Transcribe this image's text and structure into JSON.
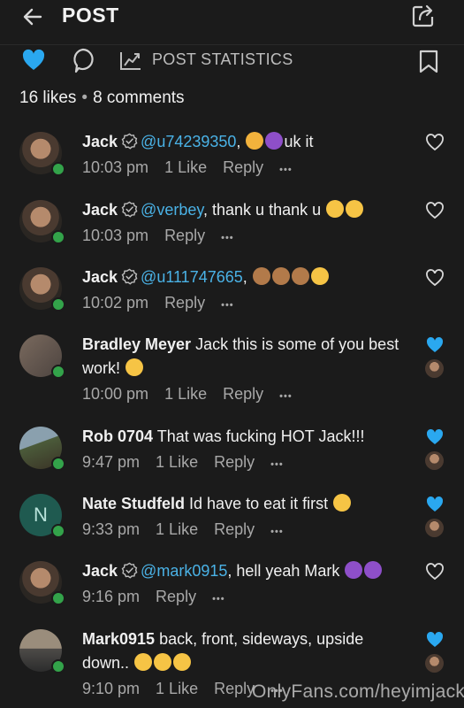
{
  "header": {
    "title": "POST"
  },
  "actions": {
    "stats_label": "POST STATISTICS",
    "accent": "#2aa8f0"
  },
  "summary": {
    "likes": "16 likes",
    "separator": "•",
    "comments": "8 comments"
  },
  "comments": [
    {
      "name": "Jack",
      "verified": true,
      "mention": "@u74239350",
      "text_before": ",",
      "emojis": [
        "flexed-biceps",
        "smiling-devil"
      ],
      "text_after": "uk it",
      "time": "10:03 pm",
      "likes": "1 Like",
      "reply": "Reply",
      "more": "•••",
      "liked": false
    },
    {
      "name": "Jack",
      "verified": true,
      "mention": "@verbey",
      "text_before": ", thank u thank u",
      "emojis": [
        "relieved-face",
        "relieved-face"
      ],
      "text_after": "",
      "time": "10:03 pm",
      "likes": "",
      "reply": "Reply",
      "more": "•••",
      "liked": false
    },
    {
      "name": "Jack",
      "verified": true,
      "mention": "@u111747665",
      "text_before": ",",
      "emojis": [
        "see-no-evil-monkey",
        "see-no-evil-monkey",
        "see-no-evil-monkey",
        "squinting-tongue-face"
      ],
      "text_after": "",
      "time": "10:02 pm",
      "likes": "",
      "reply": "Reply",
      "more": "•••",
      "liked": false
    },
    {
      "name": "Bradley Meyer",
      "verified": false,
      "mention": "",
      "text_before": "Jack this is some of you best work!",
      "emojis": [
        "heart-eyes"
      ],
      "text_after": "",
      "time": "10:00 pm",
      "likes": "1 Like",
      "reply": "Reply",
      "more": "•••",
      "liked": true
    },
    {
      "name": "Rob 0704",
      "verified": false,
      "mention": "",
      "text_before": "That was fucking HOT Jack!!!",
      "emojis": [],
      "text_after": "",
      "time": "9:47 pm",
      "likes": "1 Like",
      "reply": "Reply",
      "more": "•••",
      "liked": true
    },
    {
      "name": "Nate Studfeld",
      "verified": false,
      "mention": "",
      "text_before": "Id have to eat it first",
      "emojis": [
        "yum-face"
      ],
      "text_after": "",
      "time": "9:33 pm",
      "likes": "1 Like",
      "reply": "Reply",
      "more": "•••",
      "liked": true,
      "initial": "N"
    },
    {
      "name": "Jack",
      "verified": true,
      "mention": "@mark0915",
      "text_before": ", hell yeah Mark",
      "emojis": [
        "smiling-devil",
        "smiling-devil"
      ],
      "text_after": "",
      "time": "9:16 pm",
      "likes": "",
      "reply": "Reply",
      "more": "•••",
      "liked": false
    },
    {
      "name": "Mark0915",
      "verified": false,
      "mention": "",
      "text_before": "back, front, sideways, upside down..",
      "emojis": [
        "heart-eyes",
        "heart-eyes",
        "heart-eyes"
      ],
      "text_after": "",
      "time": "9:10 pm",
      "likes": "1 Like",
      "reply": "Reply",
      "more": "•••",
      "liked": true
    }
  ],
  "watermark": "OnlyFans.com/heyimjack"
}
